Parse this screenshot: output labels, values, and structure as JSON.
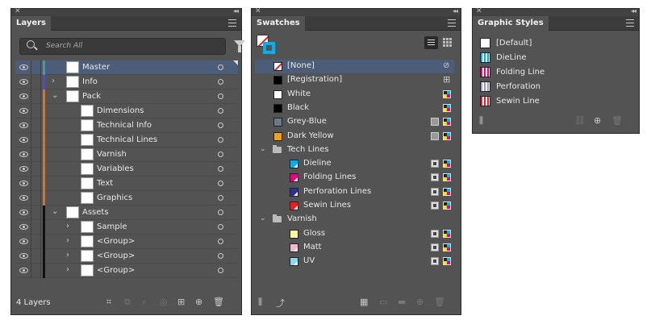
{
  "layers": {
    "tab": "Layers",
    "search_placeholder": "Search All",
    "count_label": "4 Layers",
    "rows": [
      {
        "name": "Master",
        "depth": 0,
        "twirl": "",
        "color": "#4a9a9a",
        "selected": true
      },
      {
        "name": "Info",
        "depth": 0,
        "twirl": "right",
        "color": "#4a4adc"
      },
      {
        "name": "Pack",
        "depth": 0,
        "twirl": "down",
        "color": "#e07020"
      },
      {
        "name": "Dimensions",
        "depth": 1,
        "twirl": "",
        "color": "#e07020"
      },
      {
        "name": "Technical Info",
        "depth": 1,
        "twirl": "",
        "color": "#e07020"
      },
      {
        "name": "Technical Lines",
        "depth": 1,
        "twirl": "",
        "color": "#e07020"
      },
      {
        "name": "Varnish",
        "depth": 1,
        "twirl": "",
        "color": "#e07020"
      },
      {
        "name": "Variables",
        "depth": 1,
        "twirl": "",
        "color": "#e07020"
      },
      {
        "name": "Text",
        "depth": 1,
        "twirl": "",
        "color": "#e07020"
      },
      {
        "name": "Graphics",
        "depth": 1,
        "twirl": "",
        "color": "#e07020"
      },
      {
        "name": "Assets",
        "depth": 0,
        "twirl": "down",
        "color": "#111111"
      },
      {
        "name": "Sample",
        "depth": 1,
        "twirl": "right",
        "color": "#111111"
      },
      {
        "name": "<Group>",
        "depth": 1,
        "twirl": "right",
        "color": "#111111"
      },
      {
        "name": "<Group>",
        "depth": 1,
        "twirl": "right",
        "color": "#111111"
      },
      {
        "name": "<Group>",
        "depth": 1,
        "twirl": "right",
        "color": "#111111"
      }
    ]
  },
  "swatches": {
    "tab": "Swatches",
    "rows": [
      {
        "kind": "swatch",
        "name": "[None]",
        "chip": "none",
        "selected": true,
        "right": "none"
      },
      {
        "kind": "swatch",
        "name": "[Registration]",
        "chip": "#000000",
        "right": "reg"
      },
      {
        "kind": "swatch",
        "name": "White",
        "chip": "#ffffff",
        "right": "proc"
      },
      {
        "kind": "swatch",
        "name": "Black",
        "chip": "#000000",
        "right": "proc"
      },
      {
        "kind": "swatch",
        "name": "Grey-Blue",
        "chip": "#6a7a8a",
        "right": "gray-proc"
      },
      {
        "kind": "swatch",
        "name": "Dark Yellow",
        "chip": "#f0a020",
        "right": "gray-proc"
      },
      {
        "kind": "group",
        "name": "Tech Lines"
      },
      {
        "kind": "spot",
        "name": "Dieline",
        "chip": "#00aeef"
      },
      {
        "kind": "spot",
        "name": "Folding Lines",
        "chip": "#e6007e"
      },
      {
        "kind": "spot",
        "name": "Perforation Lines",
        "chip": "#2e3192"
      },
      {
        "kind": "spot",
        "name": "Sewin Lines",
        "chip": "#ed1c24"
      },
      {
        "kind": "group",
        "name": "Varnish"
      },
      {
        "kind": "spot",
        "name": "Gloss",
        "chip": "#fff799"
      },
      {
        "kind": "spot",
        "name": "Matt",
        "chip": "#f4b6cf"
      },
      {
        "kind": "spot",
        "name": "UV",
        "chip": "#8fd8f0"
      }
    ]
  },
  "graphic_styles": {
    "tab": "Graphic Styles",
    "rows": [
      {
        "name": "[Default]",
        "color": "#ffffff"
      },
      {
        "name": "DieLine",
        "color": "#00aeef"
      },
      {
        "name": "Folding Line",
        "color": "#e6007e"
      },
      {
        "name": "Perforation",
        "color": "#9999cc"
      },
      {
        "name": "Sewin Line",
        "color": "#ed1c24"
      }
    ]
  }
}
